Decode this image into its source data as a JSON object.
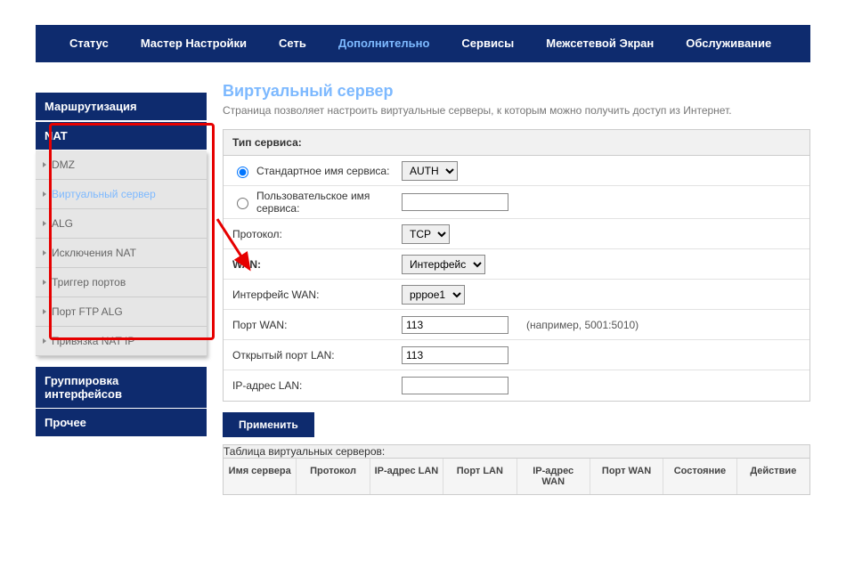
{
  "topnav": {
    "items": [
      "Статус",
      "Мастер Настройки",
      "Сеть",
      "Дополнительно",
      "Сервисы",
      "Межсетевой Экран",
      "Обслуживание"
    ],
    "activeIndex": 3
  },
  "sidebar": {
    "section_routing": "Маршрутизация",
    "section_nat": "NAT",
    "nat_items": [
      "DMZ",
      "Виртуальный сервер",
      "ALG",
      "Исключения NAT",
      "Триггер портов",
      "Порт FTP ALG",
      "Привязка NAT IP"
    ],
    "nat_active_index": 1,
    "section_iface_group": "Группировка интерфейсов",
    "section_other": "Прочее"
  },
  "main": {
    "title": "Виртуальный сервер",
    "desc": "Страница позволяет настроить виртуальные серверы, к которым можно получить доступ из Интернет."
  },
  "form": {
    "panel_title": "Тип сервиса:",
    "std_name_label": "Стандартное имя сервиса:",
    "std_name_value": "AUTH",
    "custom_name_label": "Пользовательское имя сервиса:",
    "custom_name_value": "",
    "protocol_label": "Протокол:",
    "protocol_value": "TCP",
    "wan_label": "WAN:",
    "wan_value": "Интерфейс",
    "wan_iface_label": "Интерфейс WAN:",
    "wan_iface_value": "pppoe1",
    "wan_port_label": "Порт WAN:",
    "wan_port_value": "113",
    "wan_port_hint": "(например, 5001:5010)",
    "lan_open_port_label": "Открытый порт LAN:",
    "lan_open_port_value": "113",
    "lan_ip_label": "IP-адрес LAN:",
    "lan_ip_value": "",
    "apply_label": "Применить"
  },
  "table": {
    "title": "Таблица виртуальных серверов:",
    "headers": [
      "Имя сервера",
      "Протокол",
      "IP-адрес LAN",
      "Порт LAN",
      "IP-адрес WAN",
      "Порт WAN",
      "Состояние",
      "Действие"
    ]
  }
}
